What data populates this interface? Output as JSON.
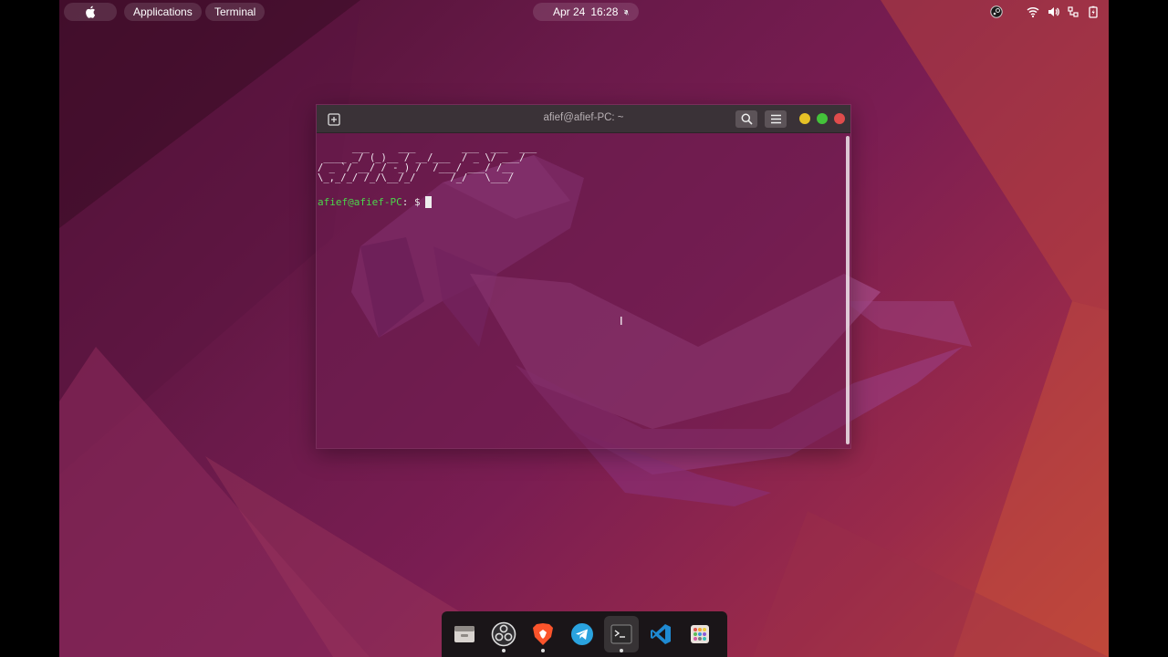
{
  "top_panel": {
    "apple_icon": "apple-logo-icon",
    "applications_label": "Applications",
    "active_app_label": "Terminal",
    "date": "Apr 24",
    "time": "16:28",
    "tray_icons": [
      "steam-icon",
      "wifi-icon",
      "volume-icon",
      "power-icon",
      "battery-icon"
    ]
  },
  "terminal": {
    "title": "afief@afief-PC: ~",
    "ascii_art": "      ___     ___        ___  ___  ___\n ____ _/ (_)__ / __/___  / _ \\/ ___/\n/ _ `/ __/ / -_) /  /___/ ___/ /__  \n\\_,_/_/ /_/\\__/_/      /_/   \\___/  ",
    "prompt_user": "afief@afief-PC",
    "prompt_suffix": ": $"
  },
  "dock": {
    "items": [
      {
        "icon": "file-manager-icon",
        "running": false
      },
      {
        "icon": "obs-icon",
        "running": true
      },
      {
        "icon": "brave-browser-icon",
        "running": true
      },
      {
        "icon": "telegram-icon",
        "running": false
      },
      {
        "icon": "terminal-icon",
        "running": true
      },
      {
        "icon": "vscode-icon",
        "running": false
      },
      {
        "icon": "app-grid-icon",
        "running": false
      }
    ]
  },
  "colors": {
    "prompt_user": "#4bd64b",
    "close": "#e04c4c",
    "minimize": "#e6c126",
    "maximize": "#44c23a"
  }
}
